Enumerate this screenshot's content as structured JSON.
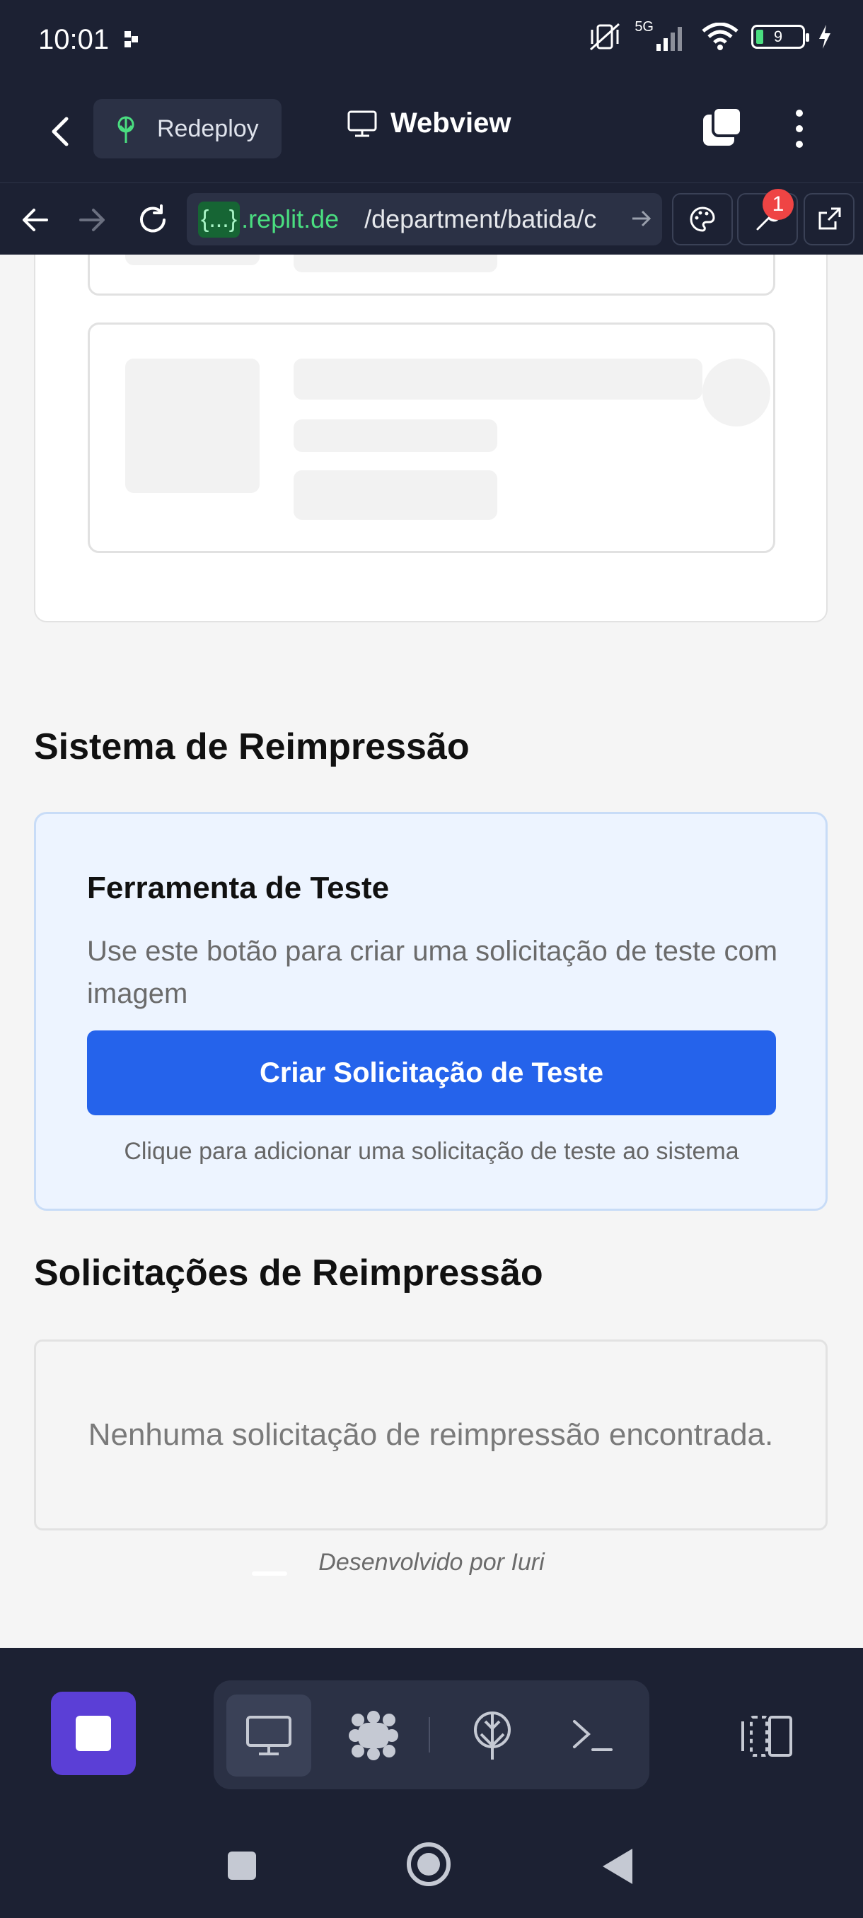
{
  "status_bar": {
    "time": "10:01",
    "network": "5G",
    "battery": "9"
  },
  "app_header": {
    "redeploy_label": "Redeploy",
    "title": "Webview"
  },
  "url_bar": {
    "badge": "{...}",
    "domain": ".replit.de",
    "path": "/department/batida/c",
    "notification_count": "1"
  },
  "page": {
    "reprint_section_title": "Sistema de Reimpressão",
    "test_tool": {
      "title": "Ferramenta de Teste",
      "description": "Use este botão para criar uma solicitação de teste com imagem",
      "button_label": "Criar Solicitação de Teste",
      "hint": "Clique para adicionar uma solicitação de teste ao sistema"
    },
    "requests_section_title": "Solicitações de Reimpressão",
    "empty_message": "Nenhuma solicitação de reimpressão encontrada.",
    "footer_credit": "Desenvolvido por Iuri"
  },
  "colors": {
    "chrome_bg": "#1c2133",
    "accent_blue": "#2563eb",
    "stop_purple": "#5b3fd6",
    "url_green": "#4ade80"
  }
}
